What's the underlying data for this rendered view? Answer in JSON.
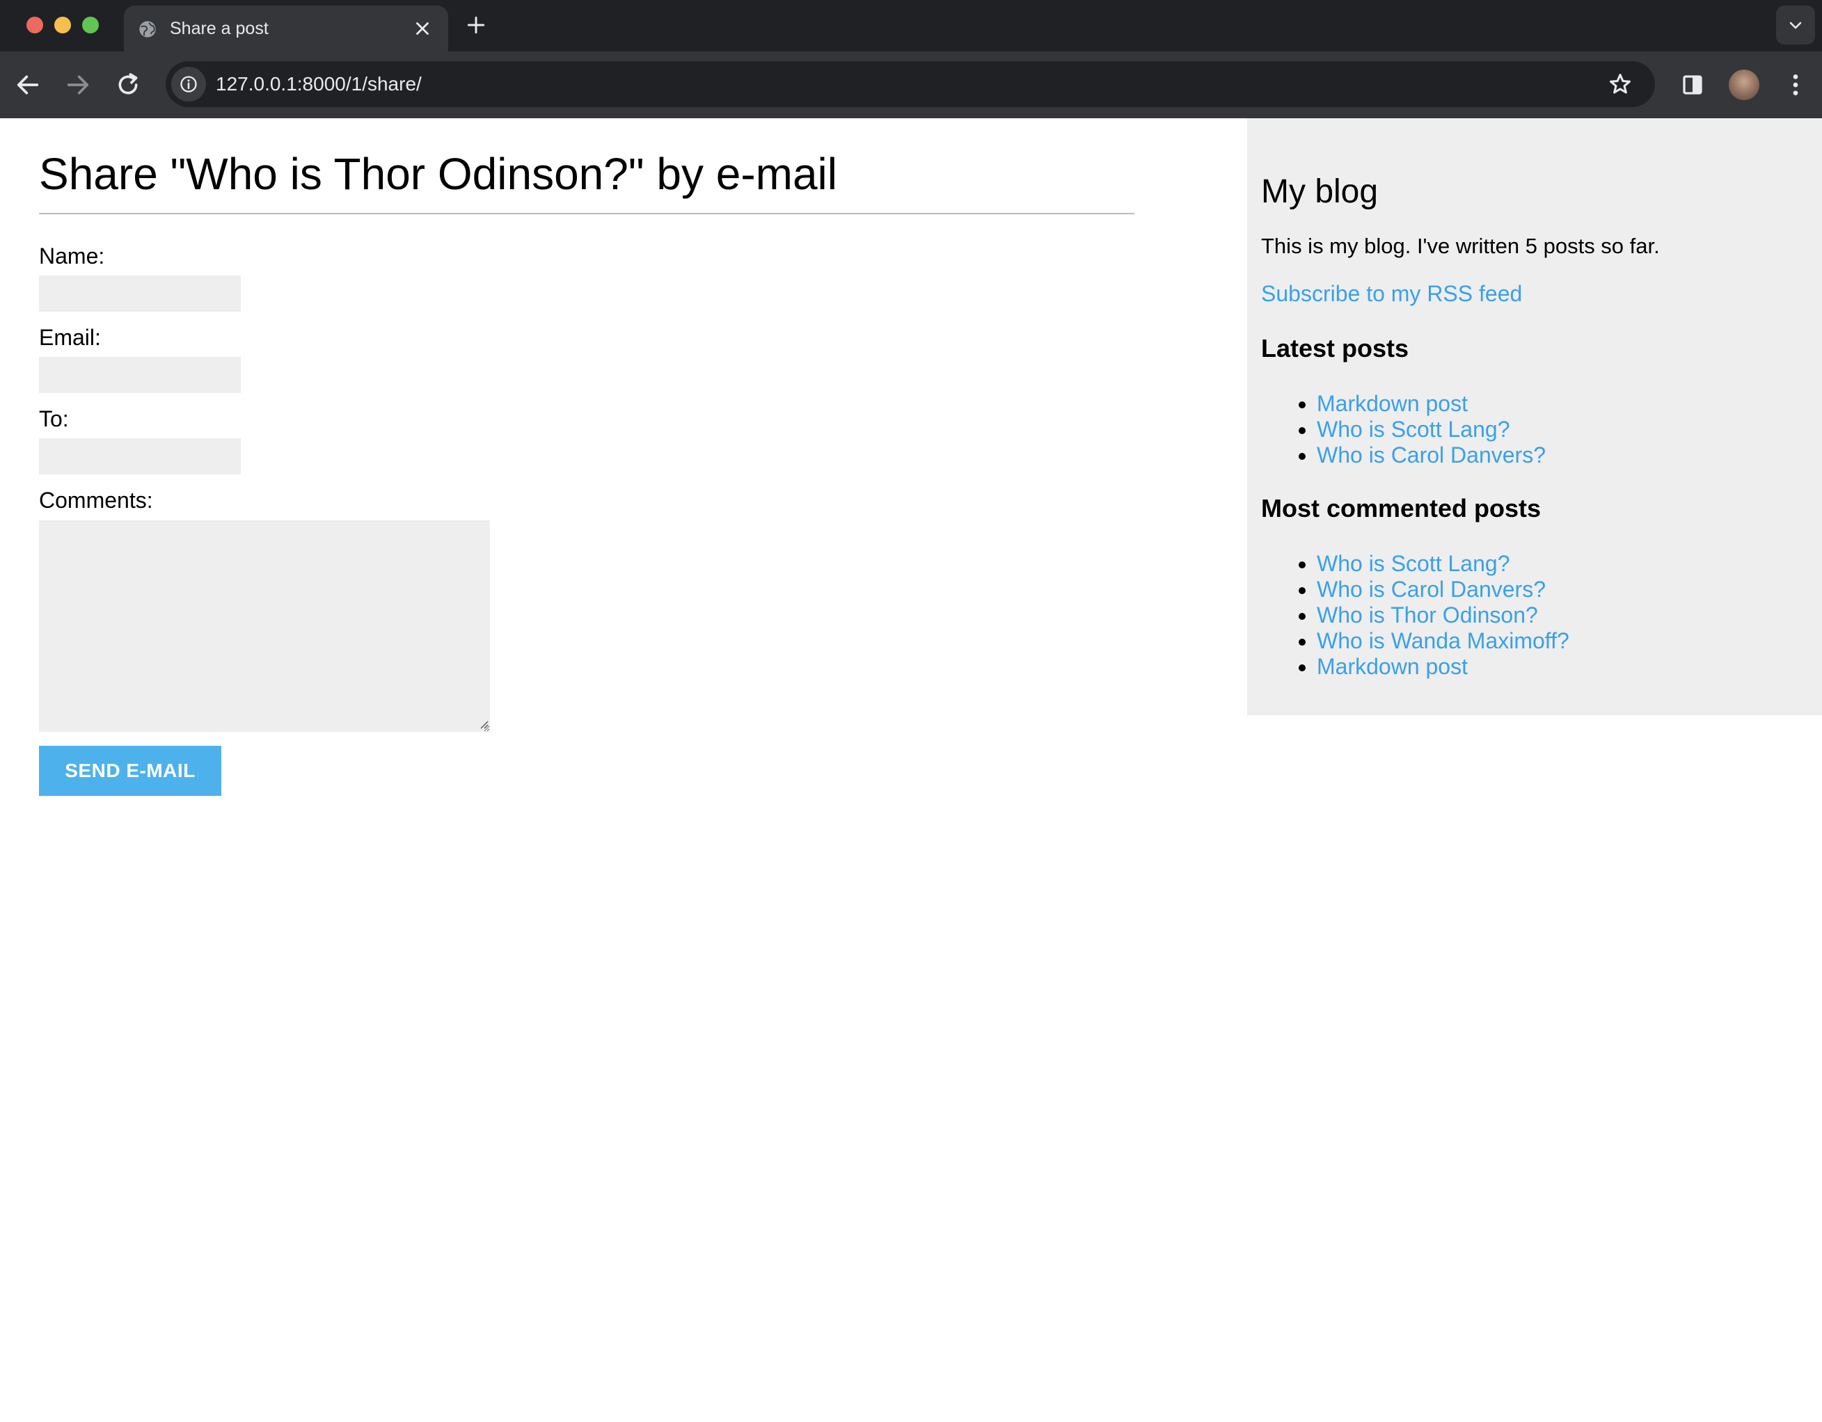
{
  "browser": {
    "tab_title": "Share a post",
    "url": "127.0.0.1:8000/1/share/"
  },
  "page": {
    "title": "Share \"Who is Thor Odinson?\" by e-mail",
    "form": {
      "name_label": "Name:",
      "email_label": "Email:",
      "to_label": "To:",
      "comments_label": "Comments:",
      "name_value": "",
      "email_value": "",
      "to_value": "",
      "comments_value": "",
      "submit_label": "SEND E-MAIL"
    }
  },
  "sidebar": {
    "title": "My blog",
    "description": "This is my blog. I've written 5 posts so far.",
    "rss_link": "Subscribe to my RSS feed",
    "latest_heading": "Latest posts",
    "latest_posts": [
      "Markdown post",
      "Who is Scott Lang?",
      "Who is Carol Danvers?"
    ],
    "most_commented_heading": "Most commented posts",
    "most_commented_posts": [
      "Who is Scott Lang?",
      "Who is Carol Danvers?",
      "Who is Thor Odinson?",
      "Who is Wanda Maximoff?",
      "Markdown post"
    ]
  },
  "colors": {
    "link": "#3aa0e8",
    "button": "#4db2ec",
    "sidebar_bg": "#eeeeee",
    "input_bg": "#eeeeee"
  },
  "icons": [
    "globe-icon",
    "close-icon",
    "plus-icon",
    "chevron-down-icon",
    "back-arrow-icon",
    "forward-arrow-icon",
    "reload-icon",
    "info-icon",
    "star-icon",
    "side-panel-icon",
    "kebab-menu-icon"
  ]
}
